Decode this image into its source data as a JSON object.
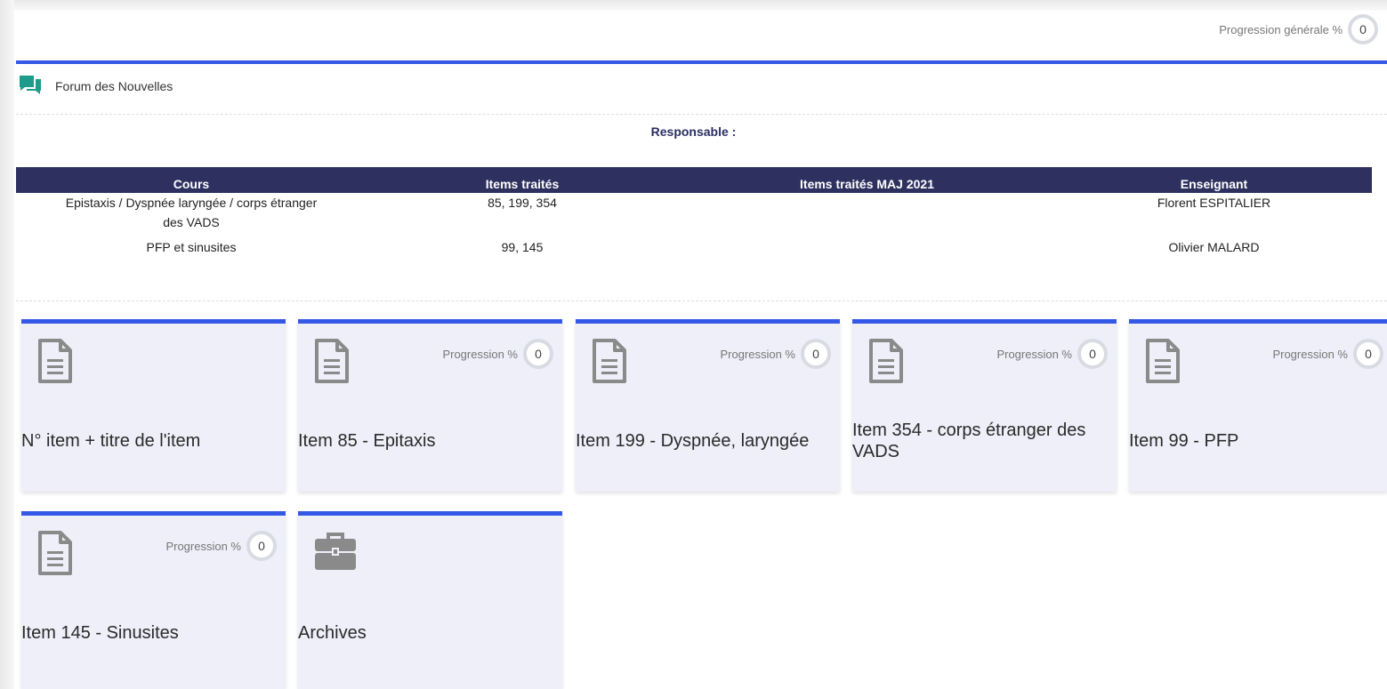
{
  "overall_progress": {
    "label": "Progression générale %",
    "value": "0"
  },
  "forum": {
    "label": "Forum des Nouvelles",
    "icon": "chat-bubbles-icon",
    "icon_color": "#1e9b8a"
  },
  "responsable_label": "Responsable :",
  "table": {
    "headers": [
      "Cours",
      "Items traités",
      "Items traités MAJ 2021",
      "Enseignant"
    ],
    "rows": [
      {
        "cours": "Epistaxis / Dyspnée laryngée / corps étranger des VADS",
        "items": "85, 199, 354",
        "maj": "",
        "enseignant": "Florent ESPITALIER"
      },
      {
        "cours": "PFP et sinusites",
        "items": "99, 145",
        "maj": "",
        "enseignant": "Olivier MALARD"
      }
    ]
  },
  "tiles": [
    {
      "title": "N° item + titre de l'item",
      "icon": "document-icon",
      "progress_label": "",
      "progress_value": ""
    },
    {
      "title": "Item 85 - Epitaxis",
      "icon": "document-icon",
      "progress_label": "Progression %",
      "progress_value": "0"
    },
    {
      "title": "Item 199 - Dyspnée, laryngée",
      "icon": "document-icon",
      "progress_label": "Progression %",
      "progress_value": "0"
    },
    {
      "title": "Item 354 - corps étranger des VADS",
      "icon": "document-icon",
      "progress_label": "Progression %",
      "progress_value": "0"
    },
    {
      "title": "Item 99 - PFP",
      "icon": "document-icon",
      "progress_label": "Progression %",
      "progress_value": "0"
    },
    {
      "title": "Item 145 - Sinusites",
      "icon": "document-icon",
      "progress_label": "Progression %",
      "progress_value": "0"
    },
    {
      "title": "Archives",
      "icon": "briefcase-icon",
      "progress_label": "",
      "progress_value": ""
    }
  ],
  "colors": {
    "accent": "#3459e6",
    "table_header": "#2e315f",
    "tile_bg": "#eeeff8"
  }
}
